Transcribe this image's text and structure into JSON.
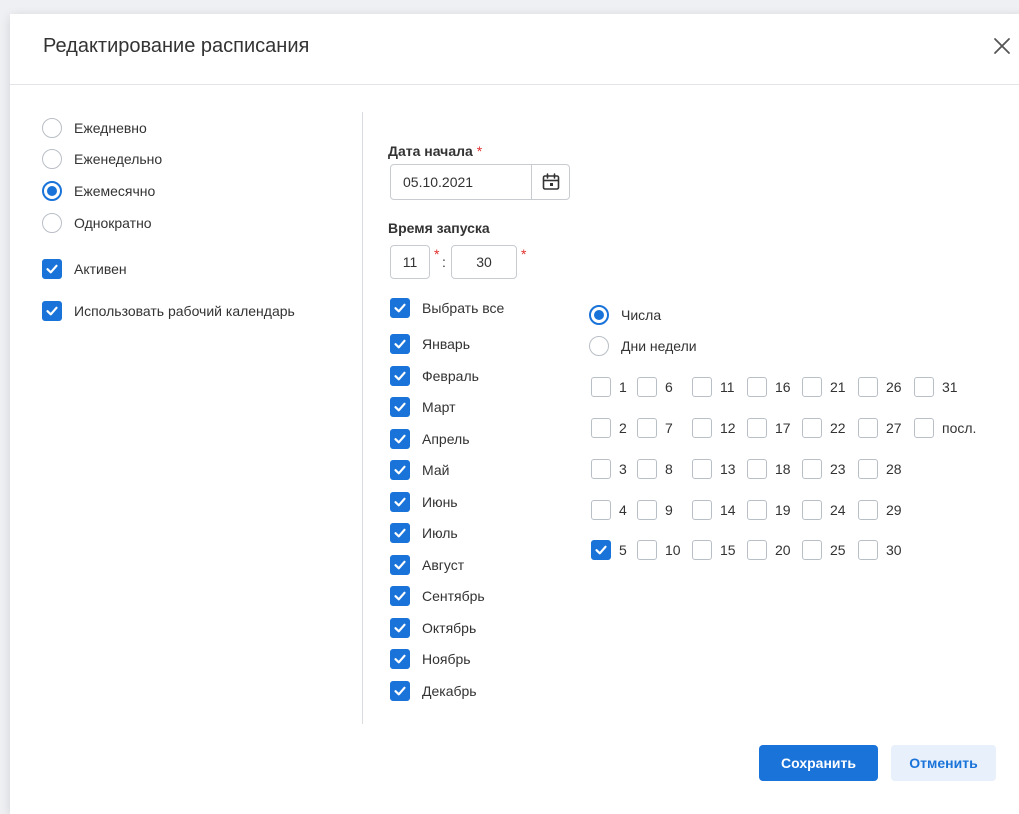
{
  "dialog": {
    "title": "Редактирование расписания",
    "close_icon": "close-icon"
  },
  "frequency": {
    "options": [
      {
        "label": "Ежедневно",
        "selected": false
      },
      {
        "label": "Еженедельно",
        "selected": false
      },
      {
        "label": "Ежемесячно",
        "selected": true
      },
      {
        "label": "Однократно",
        "selected": false
      }
    ]
  },
  "flags": {
    "active": {
      "label": "Активен",
      "checked": true
    },
    "work_calendar": {
      "label": "Использовать рабочий календарь",
      "checked": true
    }
  },
  "start_date": {
    "label": "Дата начала",
    "required_mark": "*",
    "value": "05.10.2021",
    "icon": "calendar-icon"
  },
  "start_time": {
    "label": "Время запуска",
    "hours": "11",
    "minutes": "30",
    "required_mark": "*",
    "separator": ":"
  },
  "months": {
    "select_all": {
      "label": "Выбрать все",
      "checked": true
    },
    "items": [
      {
        "label": "Январь",
        "checked": true
      },
      {
        "label": "Февраль",
        "checked": true
      },
      {
        "label": "Март",
        "checked": true
      },
      {
        "label": "Апрель",
        "checked": true
      },
      {
        "label": "Май",
        "checked": true
      },
      {
        "label": "Июнь",
        "checked": true
      },
      {
        "label": "Июль",
        "checked": true
      },
      {
        "label": "Август",
        "checked": true
      },
      {
        "label": "Сентябрь",
        "checked": true
      },
      {
        "label": "Октябрь",
        "checked": true
      },
      {
        "label": "Ноябрь",
        "checked": true
      },
      {
        "label": "Декабрь",
        "checked": true
      }
    ]
  },
  "day_mode": {
    "options": [
      {
        "label": "Числа",
        "selected": true
      },
      {
        "label": "Дни недели",
        "selected": false
      }
    ]
  },
  "days": {
    "columns": [
      [
        {
          "label": "1",
          "checked": false
        },
        {
          "label": "2",
          "checked": false
        },
        {
          "label": "3",
          "checked": false
        },
        {
          "label": "4",
          "checked": false
        },
        {
          "label": "5",
          "checked": true
        }
      ],
      [
        {
          "label": "6",
          "checked": false
        },
        {
          "label": "7",
          "checked": false
        },
        {
          "label": "8",
          "checked": false
        },
        {
          "label": "9",
          "checked": false
        },
        {
          "label": "10",
          "checked": false
        }
      ],
      [
        {
          "label": "11",
          "checked": false
        },
        {
          "label": "12",
          "checked": false
        },
        {
          "label": "13",
          "checked": false
        },
        {
          "label": "14",
          "checked": false
        },
        {
          "label": "15",
          "checked": false
        }
      ],
      [
        {
          "label": "16",
          "checked": false
        },
        {
          "label": "17",
          "checked": false
        },
        {
          "label": "18",
          "checked": false
        },
        {
          "label": "19",
          "checked": false
        },
        {
          "label": "20",
          "checked": false
        }
      ],
      [
        {
          "label": "21",
          "checked": false
        },
        {
          "label": "22",
          "checked": false
        },
        {
          "label": "23",
          "checked": false
        },
        {
          "label": "24",
          "checked": false
        },
        {
          "label": "25",
          "checked": false
        }
      ],
      [
        {
          "label": "26",
          "checked": false
        },
        {
          "label": "27",
          "checked": false
        },
        {
          "label": "28",
          "checked": false
        },
        {
          "label": "29",
          "checked": false
        },
        {
          "label": "30",
          "checked": false
        }
      ],
      [
        {
          "label": "31",
          "checked": false
        },
        {
          "label": "посл.",
          "checked": false
        }
      ]
    ]
  },
  "footer": {
    "save_label": "Сохранить",
    "cancel_label": "Отменить"
  },
  "colors": {
    "accent": "#1a73d9",
    "required": "#e0312e",
    "cancel_bg": "#e7f0fb"
  }
}
